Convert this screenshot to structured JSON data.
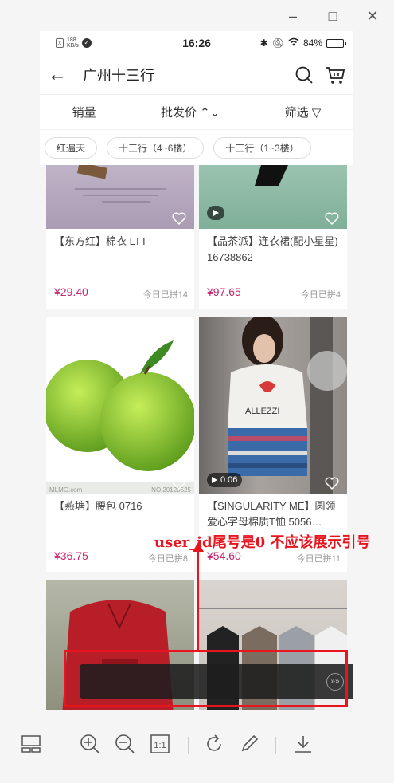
{
  "window": {
    "controls": {
      "minimize": "–",
      "maximize": "□",
      "close": "✕"
    }
  },
  "status_bar": {
    "sim_label": "x",
    "net_speed_top": "188",
    "net_speed_bottom": "KB/s",
    "time": "16:26",
    "battery": "84%",
    "battery_level": 0.84
  },
  "app_bar": {
    "back": "←",
    "title": "广州十三行"
  },
  "sort_bar": {
    "items": [
      "销量",
      "批发价 ⌃⌄",
      "筛选 ▽"
    ]
  },
  "chips": [
    "红遍天",
    "十三行（4~6楼）",
    "十三行（1~3楼）"
  ],
  "products": [
    {
      "name": "【东方红】棉衣 LTT",
      "price": "¥29.40",
      "sold": "今日已拼14"
    },
    {
      "name": "【品茶派】连衣裙(配小星星) 16738862",
      "price": "¥97.65",
      "sold": "今日已拼4"
    },
    {
      "name": "【燕塘】腰包 0716",
      "price": "¥36.75",
      "sold": "今日已拼8",
      "watermark_left": "MLMG.com",
      "watermark_right": "NO.20120525"
    },
    {
      "name": "【SINGULARITY ME】圆领爱心字母棉质T恤 5056…",
      "price": "¥54.60",
      "sold": "今日已拼11",
      "video_time": "0:06"
    },
    {
      "name": "",
      "price": "",
      "sold": ""
    },
    {
      "name": "",
      "price": "",
      "sold": ""
    }
  ],
  "annotation": {
    "text": "user_id尾号是0 不应该展示引号",
    "color": "#e8141e"
  },
  "colors": {
    "price": "#c4266d",
    "annotation": "#e8141e"
  }
}
